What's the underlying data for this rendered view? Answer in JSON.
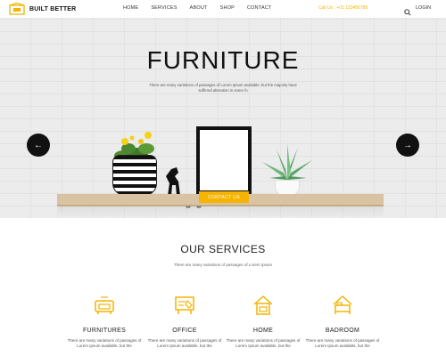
{
  "header": {
    "logo_text": "BUILT BETTER",
    "nav": [
      "HOME",
      "SERVICES",
      "ABOUT",
      "SHOP",
      "CONTACT"
    ],
    "email": "Call Us : +01 123456789",
    "login": "LOGIN"
  },
  "hero": {
    "title": "FURNITURE",
    "subtitle": "There are many variations of passages of Lorem Ipsum available, but the majority have suffered alteration in some fo",
    "cta": "CONTACT US",
    "accent_color": "#f4b400"
  },
  "services": {
    "title": "OUR SERVICES",
    "subtitle": "There are many variations of passages of Lorem Ipsum",
    "items": [
      {
        "name": "FURNITURES",
        "icon": "sofa-icon",
        "desc": "There are many variations of passages of Lorem Ipsum available, but the"
      },
      {
        "name": "OFFICE",
        "icon": "office-desk-icon",
        "desc": "There are many variations of passages of Lorem Ipsum available, but the"
      },
      {
        "name": "HOME",
        "icon": "home-icon",
        "desc": "There are many variations of passages of Lorem Ipsum available, but the"
      },
      {
        "name": "BADROOM",
        "icon": "bed-icon",
        "desc": "There are many variations of passages of Lorem Ipsum available, but the"
      }
    ]
  }
}
